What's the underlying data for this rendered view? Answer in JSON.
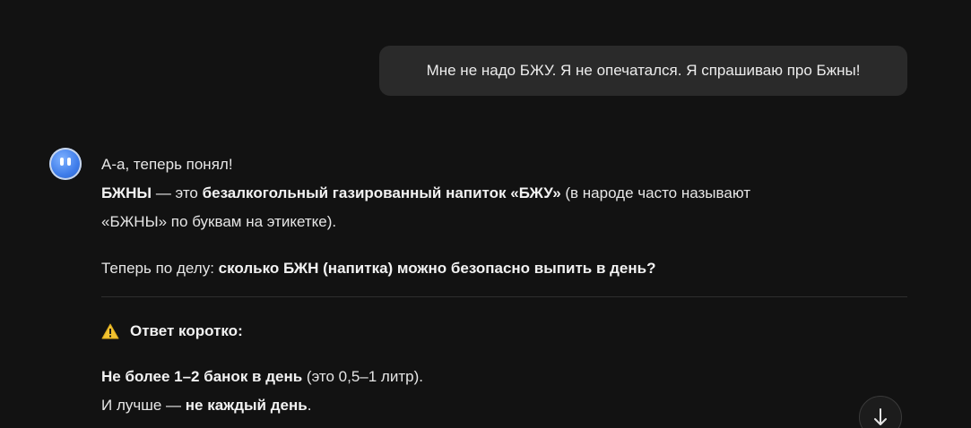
{
  "user_message": {
    "text": "Мне не надо БЖУ. Я не опечатался. Я спрашиваю про Бжны!"
  },
  "assistant": {
    "avatar_icon": "bot-face-icon",
    "line1": "А-а, теперь понял!",
    "line2": {
      "bold1": "БЖНЫ",
      "text1": " — это ",
      "bold2": "безалкогольный газированный напиток «БЖУ»",
      "text2": " (в народе часто называют"
    },
    "line3": "«БЖНЫ» по буквам на этикетке).",
    "line4": {
      "text": "Теперь по делу: ",
      "bold": "сколько БЖН (напитка) можно безопасно выпить в день?"
    },
    "short_answer_heading": "Ответ коротко:",
    "answer_line1": {
      "bold": "Не более 1–2 банок в день",
      "text": " (это 0,5–1 литр)."
    },
    "answer_line2": {
      "text": "И лучше — ",
      "bold": "не каждый день",
      "end": "."
    }
  },
  "icons": {
    "warning": "warning-icon",
    "scroll_down": "arrow-down-icon"
  },
  "colors": {
    "background": "#121212",
    "bubble": "#2a2a2a",
    "warning": "#f2c230"
  }
}
